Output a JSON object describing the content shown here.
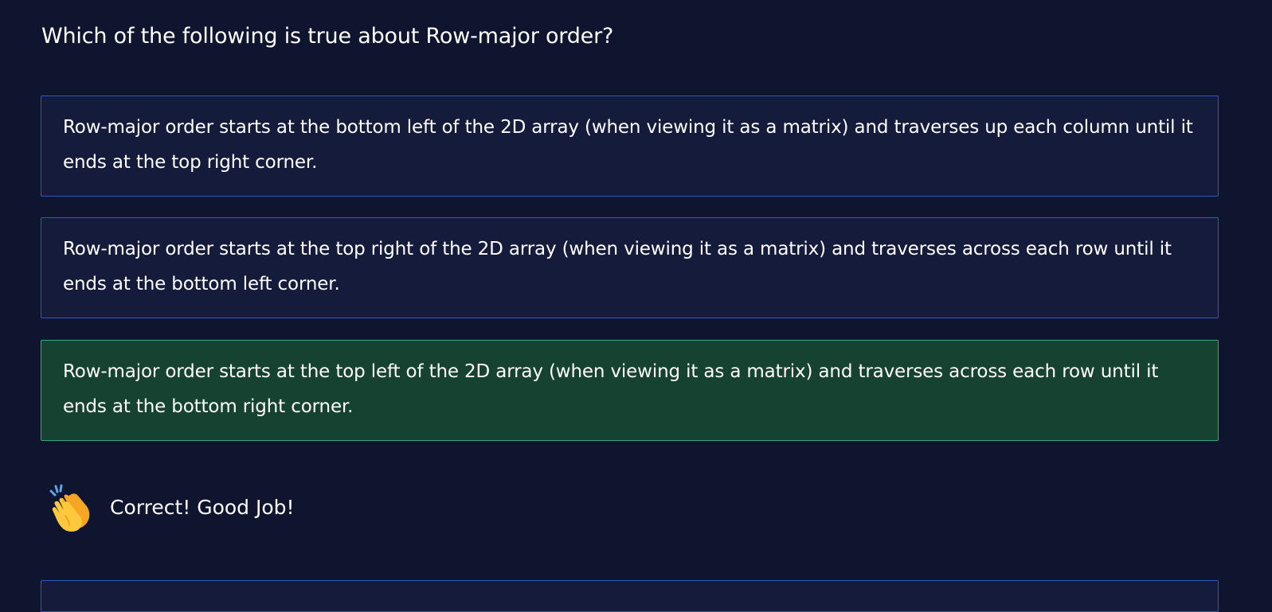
{
  "question": {
    "text": "Which of the following is true about Row-major order?"
  },
  "options": [
    {
      "text": "Row-major order starts at the bottom left of the 2D array (when viewing it as a matrix) and traverses up each column until it ends at the top right corner.",
      "state": "default"
    },
    {
      "text": "Row-major order starts at the top right of the 2D array (when viewing it as a matrix) and traverses across each row until it ends at the bottom left corner.",
      "state": "default"
    },
    {
      "text": "Row-major order starts at the top left of the 2D array (when viewing it as a matrix) and traverses across each row until it ends at the bottom right corner.",
      "state": "correct"
    }
  ],
  "feedback": {
    "icon": "clapping-hands-icon",
    "text": "Correct! Good Job!"
  },
  "colors": {
    "background": "#10152f",
    "option_background": "#141b3b",
    "option_border": "#2f56c9",
    "correct_background": "#164232",
    "correct_border": "#2fae7d",
    "text": "#ffffff"
  }
}
